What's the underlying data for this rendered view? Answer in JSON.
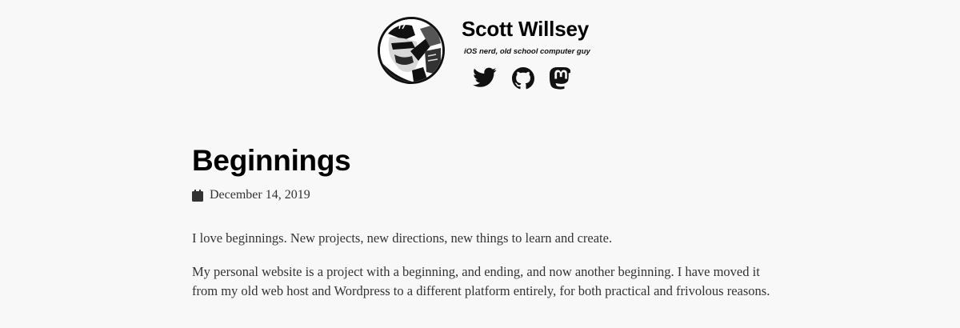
{
  "header": {
    "site_title": "Scott Willsey",
    "tagline": "iOS nerd, old school computer guy",
    "social": [
      {
        "icon": "twitter-icon"
      },
      {
        "icon": "github-icon"
      },
      {
        "icon": "mastodon-icon"
      }
    ]
  },
  "post": {
    "title": "Beginnings",
    "date": "December 14, 2019",
    "date_icon": "calendar-icon",
    "paragraphs": [
      "I love beginnings. New projects, new directions, new things to learn and create.",
      "My personal website is a project with a beginning, and ending, and now another beginning. I have moved it from my old web host and Wordpress to a different platform entirely, for both practical and frivolous reasons."
    ]
  },
  "colors": {
    "background": "#f8f8f8",
    "title_text": "#000000",
    "body_text": "#333333"
  }
}
